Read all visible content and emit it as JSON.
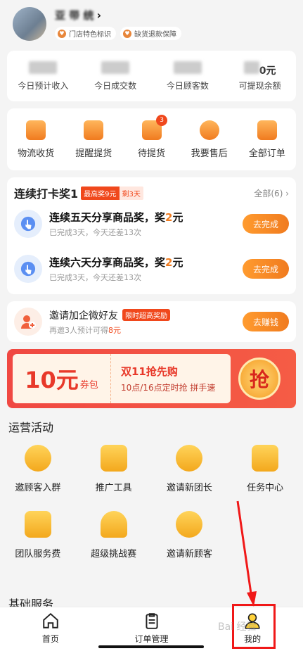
{
  "header": {
    "store_name": "亚 带 统",
    "tags": [
      "门店特色标识",
      "缺货退款保障"
    ]
  },
  "stats": [
    {
      "label": "今日预计收入"
    },
    {
      "label": "今日成交数"
    },
    {
      "label": "今日顾客数"
    },
    {
      "label": "可提现余额",
      "value_suffix": "0元"
    }
  ],
  "orders": [
    {
      "label": "物流收货",
      "icon": "truck-icon"
    },
    {
      "label": "提醒提货",
      "icon": "megaphone-icon"
    },
    {
      "label": "待提货",
      "icon": "box-icon",
      "badge": "3"
    },
    {
      "label": "我要售后",
      "icon": "refund-icon"
    },
    {
      "label": "全部订单",
      "icon": "list-icon"
    }
  ],
  "tasks": {
    "title": "连续打卡奖1",
    "max_reward": "最高奖9元",
    "days_left": "剩3天",
    "more": "全部(6)",
    "items": [
      {
        "title_pre": "连续五天分享商品奖，奖",
        "amount": "2",
        "unit": "元",
        "sub": "已完成3天，今天还差13次",
        "button": "去完成"
      },
      {
        "title_pre": "连续六天分享商品奖，奖",
        "amount": "2",
        "unit": "元",
        "sub": "已完成3天，今天还差13次",
        "button": "去完成"
      }
    ]
  },
  "invite": {
    "title": "邀请加企微好友",
    "tag": "限时超高奖励",
    "sub_pre": "再邀3人预计可得",
    "amount": "8元",
    "button": "去赚钱"
  },
  "banner": {
    "amount": "10元",
    "unit": "券包",
    "title": "双11抢先购",
    "sub": "10点/16点定时抢 拼手速",
    "grab": "抢"
  },
  "operations": {
    "title": "运营活动",
    "items": [
      {
        "label": "邀顾客入群",
        "icon": "group-chat-icon"
      },
      {
        "label": "推广工具",
        "icon": "promo-tool-icon"
      },
      {
        "label": "邀请新团长",
        "icon": "add-leader-icon"
      },
      {
        "label": "任务中心",
        "icon": "task-clipboard-icon"
      },
      {
        "label": "团队服务费",
        "icon": "service-fee-icon"
      },
      {
        "label": "超级挑战赛",
        "icon": "trophy-icon"
      },
      {
        "label": "邀请新顾客",
        "icon": "add-customer-icon"
      }
    ]
  },
  "basic_services": {
    "title": "基础服务"
  },
  "tabbar": [
    {
      "label": "首页",
      "icon": "home-icon"
    },
    {
      "label": "订单管理",
      "icon": "clipboard-icon"
    },
    {
      "label": "我的",
      "icon": "user-icon"
    }
  ],
  "watermark": "Bai 经验",
  "colors": {
    "accent": "#f07b1f",
    "red": "#f0481c",
    "highlight": "#f01818"
  }
}
